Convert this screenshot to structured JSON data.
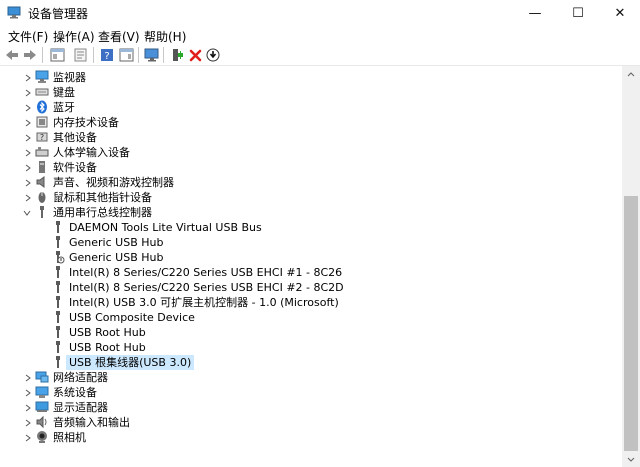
{
  "window": {
    "title": "设备管理器",
    "min_glyph": "—",
    "max_glyph": "☐",
    "close_glyph": "✕"
  },
  "menu": [
    "文件(F)",
    "操作(A)",
    "查看(V)",
    "帮助(H)"
  ],
  "toolbar": {
    "buttons": [
      "back-icon",
      "forward-icon",
      "show-hide-console-tree-icon",
      "properties-icon",
      "help-icon",
      "show-action-pane-icon",
      "scan-hardware-icon",
      "add-driver-icon",
      "uninstall-icon",
      "update-driver-icon"
    ]
  },
  "tree": {
    "categories_top": [
      {
        "label": "监视器",
        "icon": "monitor-icon"
      },
      {
        "label": "键盘",
        "icon": "keyboard-icon"
      },
      {
        "label": "蓝牙",
        "icon": "bluetooth-icon"
      },
      {
        "label": "内存技术设备",
        "icon": "memory-icon"
      },
      {
        "label": "其他设备",
        "icon": "unknown-device-icon"
      },
      {
        "label": "人体学输入设备",
        "icon": "hid-icon"
      },
      {
        "label": "软件设备",
        "icon": "software-device-icon"
      },
      {
        "label": "声音、视频和游戏控制器",
        "icon": "speaker-icon"
      },
      {
        "label": "鼠标和其他指针设备",
        "icon": "mouse-icon"
      }
    ],
    "usb_category": {
      "label": "通用串行总线控制器",
      "icon": "usb-icon"
    },
    "usb_children": [
      "DAEMON Tools Lite Virtual USB Bus",
      "Generic USB Hub",
      "Generic USB Hub",
      "Intel(R) 8 Series/C220 Series USB EHCI #1 - 8C26",
      "Intel(R) 8 Series/C220 Series USB EHCI #2 - 8C2D",
      "Intel(R) USB 3.0 可扩展主机控制器 - 1.0 (Microsoft)",
      "USB Composite Device",
      "USB Root Hub",
      "USB Root Hub",
      "USB 根集线器(USB 3.0)"
    ],
    "categories_bottom": [
      {
        "label": "网络适配器",
        "icon": "network-adapter-icon"
      },
      {
        "label": "系统设备",
        "icon": "system-device-icon"
      },
      {
        "label": "显示适配器",
        "icon": "display-adapter-icon"
      },
      {
        "label": "音频输入和输出",
        "icon": "audio-io-icon"
      },
      {
        "label": "照相机",
        "icon": "camera-icon"
      }
    ],
    "selected_child": "USB 根集线器(USB 3.0)"
  }
}
